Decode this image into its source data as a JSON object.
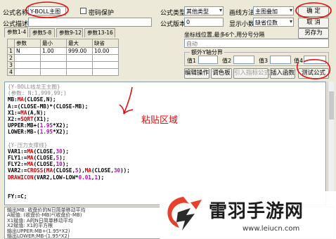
{
  "top": {
    "name_label": "公式名称",
    "name_value": "Y-BOLL主图",
    "password_label": "密码保护",
    "desc_label": "公式描述",
    "type_label": "公式类型",
    "type_value": "其他类型",
    "draw_label": "画线方法",
    "draw_value": "主图叠加",
    "version_label": "公式版本",
    "version_value": "0",
    "decimal_label": "显示小数",
    "decimal_value": "缺省位数",
    "ok_label": "确 定",
    "cancel_label": "取 消",
    "saveas_label": "另存为"
  },
  "tabs": [
    "参数1-4",
    "参数5-8",
    "参数9-12",
    "参数13-16"
  ],
  "params": {
    "headers": [
      "参数",
      "最小",
      "最大",
      "缺省"
    ],
    "rows": [
      {
        "index": "1",
        "name": "N",
        "min": "1.00",
        "max": "999.00",
        "default": "10.00"
      },
      {
        "index": "2",
        "name": "",
        "min": "",
        "max": "",
        "default": ""
      },
      {
        "index": "3",
        "name": "",
        "min": "",
        "max": "",
        "default": ""
      },
      {
        "index": "4",
        "name": "",
        "min": "",
        "max": "",
        "default": ""
      }
    ]
  },
  "right": {
    "coord_hint": "坐标线位置,最多6个,用分号分隔",
    "coord_value": "自动",
    "group_title": "额外Y轴分界",
    "val1": "值1",
    "val2": "值2",
    "val3": "值3",
    "val4": "值4",
    "buttons": [
      "编辑操作",
      "调色板",
      "引入指标公式",
      "插入函数",
      "测试公式"
    ]
  },
  "editor_lines": [
    [
      {
        "t": "{Y-BOLL线龙王主图}",
        "c": "c-gray"
      }
    ],
    [
      {
        "t": "(参数: N:1,999,99;)",
        "c": "c-gray"
      }
    ],
    [
      {
        "t": "MB:",
        "c": "c-blk"
      },
      {
        "t": "MA",
        "c": "c-red"
      },
      {
        "t": "(CLOSE,N);",
        "c": "c-blk"
      }
    ],
    [
      {
        "t": "A:=(CLOSE-MB)*(CLOSE-MB);",
        "c": "c-blk"
      }
    ],
    [
      {
        "t": "X1:=",
        "c": "c-blk"
      },
      {
        "t": "MA",
        "c": "c-red"
      },
      {
        "t": "(A,N);",
        "c": "c-blk"
      }
    ],
    [
      {
        "t": "X2:=",
        "c": "c-blk"
      },
      {
        "t": "SQRT",
        "c": "c-red"
      },
      {
        "t": "(X1);",
        "c": "c-blk"
      }
    ],
    [
      {
        "t": "UPPER:MB+(",
        "c": "c-blk"
      },
      {
        "t": "1.95",
        "c": "c-mag"
      },
      {
        "t": "*X2);",
        "c": "c-blk"
      }
    ],
    [
      {
        "t": "LOWER:MB-(",
        "c": "c-blk"
      },
      {
        "t": "1.95",
        "c": "c-mag"
      },
      {
        "t": "*X2);",
        "c": "c-blk"
      }
    ],
    [
      {
        "t": "",
        "c": "c-blk"
      }
    ],
    [
      {
        "t": "{Y-压力支撑线}",
        "c": "c-gray"
      }
    ],
    [
      {
        "t": "VAR1:=",
        "c": "c-blk"
      },
      {
        "t": "MA",
        "c": "c-red"
      },
      {
        "t": "(CLOSE,",
        "c": "c-blk"
      },
      {
        "t": "30",
        "c": "c-mag"
      },
      {
        "t": ");",
        "c": "c-blk"
      }
    ],
    [
      {
        "t": "FLY1:=",
        "c": "c-blk"
      },
      {
        "t": "MA",
        "c": "c-red"
      },
      {
        "t": "(CLOSE,",
        "c": "c-blk"
      },
      {
        "t": "5",
        "c": "c-mag"
      },
      {
        "t": ");",
        "c": "c-blk"
      }
    ],
    [
      {
        "t": "FLY2:=",
        "c": "c-blk"
      },
      {
        "t": "MA",
        "c": "c-red"
      },
      {
        "t": "(CLOSE,",
        "c": "c-blk"
      },
      {
        "t": "10",
        "c": "c-mag"
      },
      {
        "t": ");",
        "c": "c-blk"
      }
    ],
    [
      {
        "t": "VAR2:=",
        "c": "c-blk"
      },
      {
        "t": "CROSS",
        "c": "c-red"
      },
      {
        "t": "(",
        "c": "c-blk"
      },
      {
        "t": "MA",
        "c": "c-red"
      },
      {
        "t": "(CLOSE,",
        "c": "c-blk"
      },
      {
        "t": "5",
        "c": "c-mag"
      },
      {
        "t": "),",
        "c": "c-blk"
      },
      {
        "t": "MA",
        "c": "c-red"
      },
      {
        "t": "(CLOSE,",
        "c": "c-blk"
      },
      {
        "t": "30",
        "c": "c-mag"
      },
      {
        "t": "));",
        "c": "c-blk"
      }
    ],
    [
      {
        "t": "DRAWICON",
        "c": "c-red"
      },
      {
        "t": "(VAR2,LOW-LOW*",
        "c": "c-blk"
      },
      {
        "t": "0.01",
        "c": "c-mag"
      },
      {
        "t": ",",
        "c": "c-blk"
      },
      {
        "t": "1",
        "c": "c-mag"
      },
      {
        "t": ");",
        "c": "c-blk"
      }
    ],
    [
      {
        "t": "",
        "c": "c-blk"
      }
    ],
    [
      {
        "t": "",
        "c": "c-blk"
      }
    ],
    [
      {
        "t": "FY:=C;",
        "c": "c-blk"
      }
    ]
  ],
  "paste_annotation": "粘贴区域",
  "output_lines": [
    "输出MB: 收盘价的N日简单移动平均",
    "A赋值: (收盘价-MB)*(收盘价-MB)",
    "X1赋值: A的N日简单移动平均",
    "X2赋值: X1的平方根",
    "输出UPPER:MB+(1.95*X2)",
    "输出LOWER:MB-(1.95*X2)"
  ],
  "watermark": {
    "title": "雷羽手游网",
    "url": "www.leiucn.com"
  },
  "colors": {
    "annotation_red": "#e01010",
    "logo_red": "#e8402a",
    "logo_dark": "#2a2a2a"
  }
}
